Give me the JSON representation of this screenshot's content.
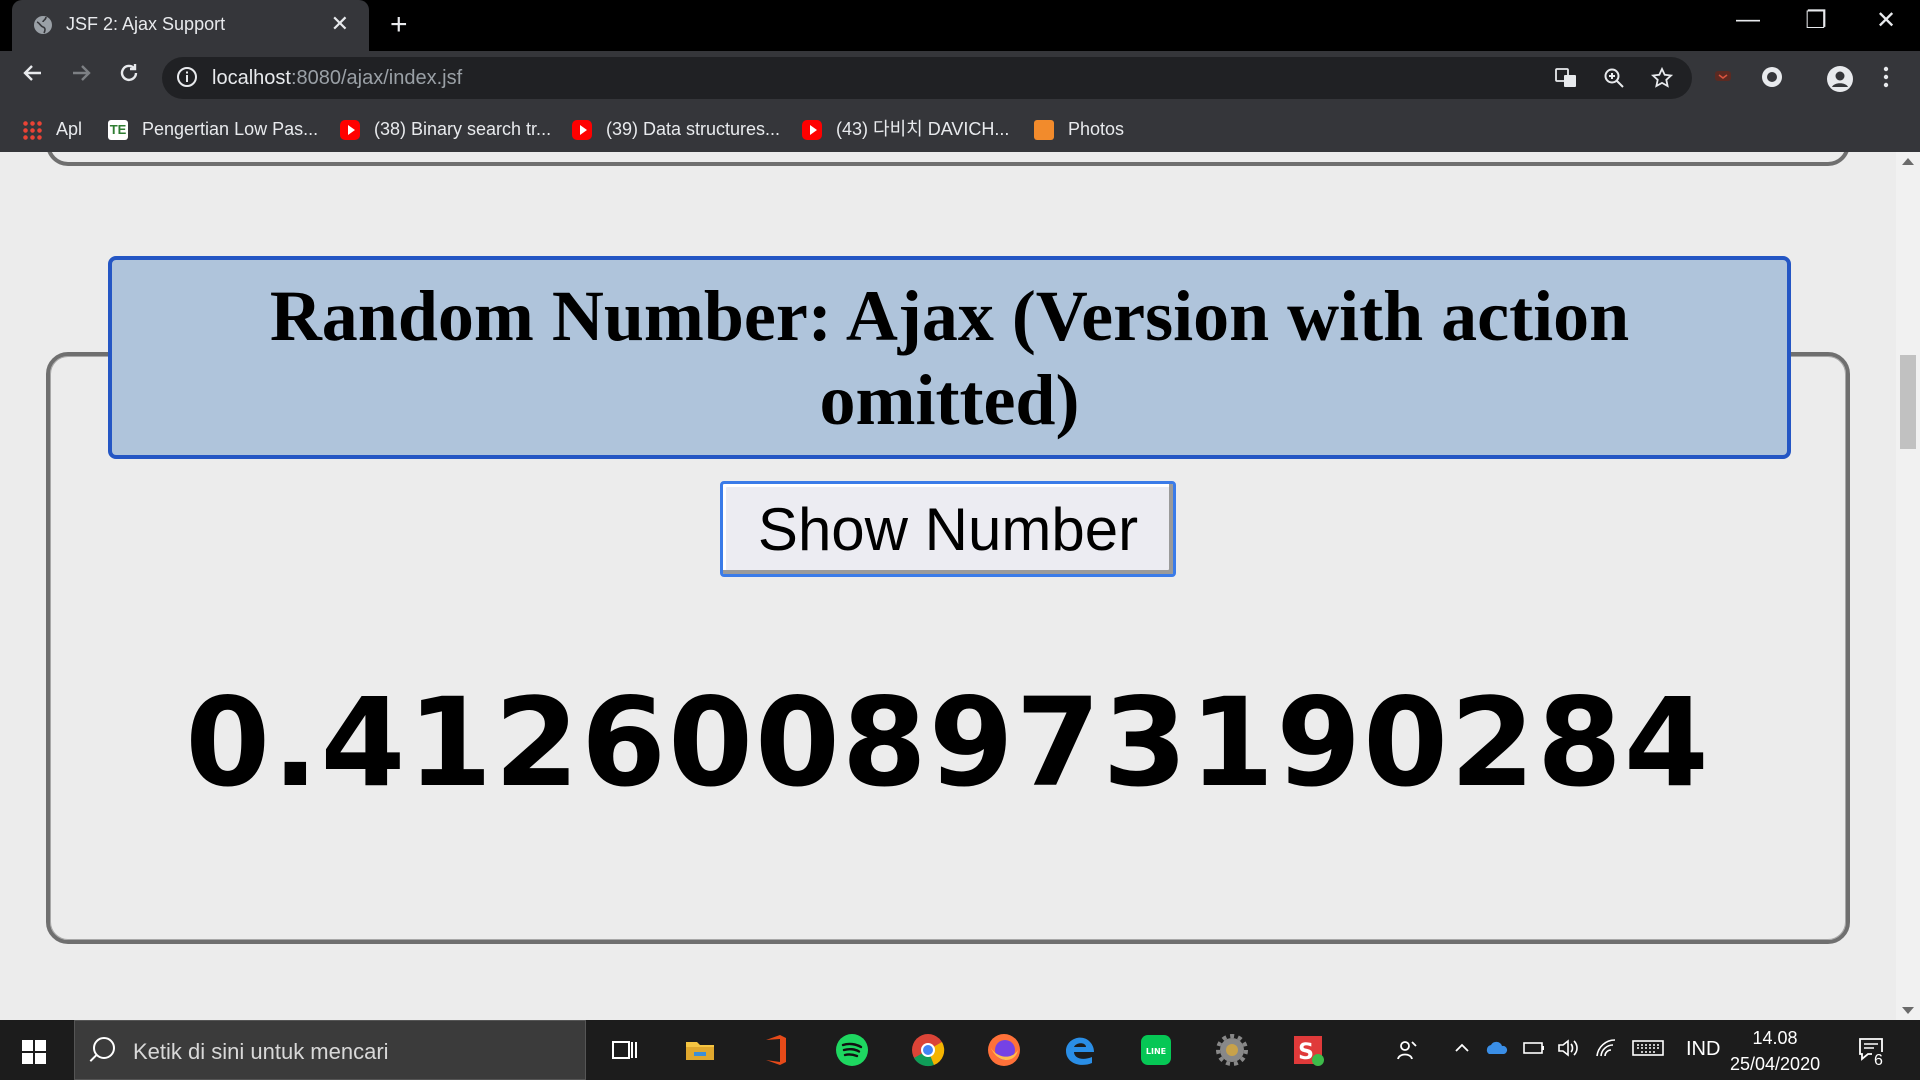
{
  "browser": {
    "tab_title": "JSF 2: Ajax Support",
    "tab_close": "✕",
    "new_tab": "+",
    "window_controls": [
      "—",
      "❐",
      "✕"
    ],
    "url_host": "localhost",
    "url_path": ":8080/ajax/index.jsf",
    "bookmarks": [
      {
        "label": "Apl",
        "icon": "apps-grid-icon"
      },
      {
        "label": "Pengertian Low Pas...",
        "icon": "te-site-icon"
      },
      {
        "label": "(38) Binary search tr...",
        "icon": "youtube-icon"
      },
      {
        "label": "(39) Data structures...",
        "icon": "youtube-icon"
      },
      {
        "label": "(43) 다비치 DAVICH...",
        "icon": "youtube-icon"
      },
      {
        "label": "Photos",
        "icon": "photos-icon"
      }
    ]
  },
  "page": {
    "heading": "Random Number: Ajax (Version with action omitted)",
    "button_label": "Show Number",
    "result_value": "0.41260089731902​84"
  },
  "taskbar": {
    "search_placeholder": "Ketik di sini untuk mencari",
    "language": "IND",
    "time": "14.08",
    "date": "25/04/2020",
    "notification_count": "6"
  },
  "colors": {
    "title_bg": "#afc4db",
    "title_border": "#2456c4",
    "button_border": "#3a7be8",
    "chrome_dark": "#35363a"
  }
}
